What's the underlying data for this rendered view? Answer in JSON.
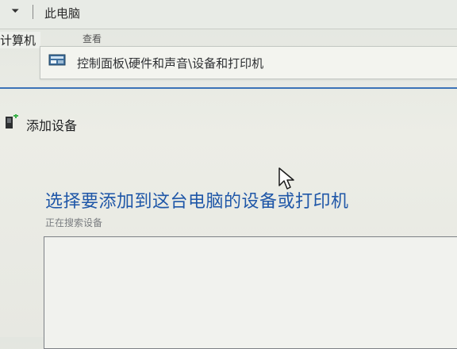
{
  "window": {
    "title": "此电脑"
  },
  "ribbon": {
    "tab_left": "计算机",
    "tab_right": "查看"
  },
  "address_bar": {
    "path": "控制面板\\硬件和声音\\设备和打印机",
    "icon": "control-panel-icon"
  },
  "dialog": {
    "title": "添加设备",
    "title_icon": "add-device-icon",
    "instruction": "选择要添加到这台电脑的设备或打印机",
    "status": "正在搜索设备"
  },
  "colors": {
    "instruction": "#1f57a8",
    "accent_line": "#3c73b7"
  }
}
